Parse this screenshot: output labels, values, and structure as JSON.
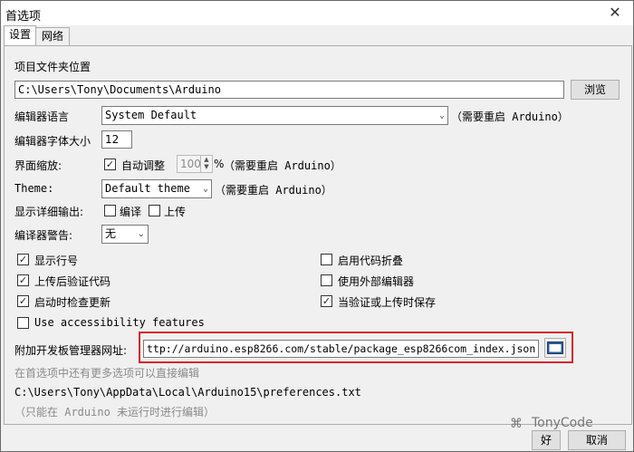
{
  "window": {
    "title": "首选项"
  },
  "tabs": [
    {
      "label": "设置"
    },
    {
      "label": "网络"
    }
  ],
  "sketchbook": {
    "label": "项目文件夹位置",
    "path": "C:\\Users\\Tony\\Documents\\Arduino",
    "browse_label": "浏览"
  },
  "editor_language": {
    "label": "编辑器语言",
    "value": "System Default",
    "note": "（需要重启 Arduino）"
  },
  "font_size": {
    "label": "编辑器字体大小",
    "value": "12"
  },
  "scale": {
    "label": "界面缩放:",
    "auto_label": "自动调整",
    "value": "100",
    "unit": "%",
    "note": "（需要重启 Arduino）"
  },
  "theme": {
    "label": "Theme:",
    "value": "Default theme",
    "note": "（需要重启 Arduino）"
  },
  "verbose": {
    "label": "显示详细输出:",
    "compile_label": "编译",
    "upload_label": "上传"
  },
  "warnings": {
    "label": "编译器警告:",
    "value": "无"
  },
  "options": {
    "show_line_numbers": "显示行号",
    "verify_after_upload": "上传后验证代码",
    "check_updates": "启动时检查更新",
    "accessibility": "Use accessibility features",
    "code_folding": "启用代码折叠",
    "external_editor": "使用外部编辑器",
    "save_on_verify": "当验证或上传时保存"
  },
  "board_urls": {
    "label": "附加开发板管理器网址:",
    "value": "ttp://arduino.esp8266.com/stable/package_esp8266com_index.json"
  },
  "footer": {
    "more_prefs": "在首选项中还有更多选项可以直接编辑",
    "prefs_path": "C:\\Users\\Tony\\AppData\\Local\\Arduino15\\preferences.txt",
    "edit_note": "（只能在 Arduino 未运行时进行编辑）"
  },
  "buttons": {
    "ok": "好",
    "cancel": "取消"
  },
  "watermark": "TonyCode"
}
